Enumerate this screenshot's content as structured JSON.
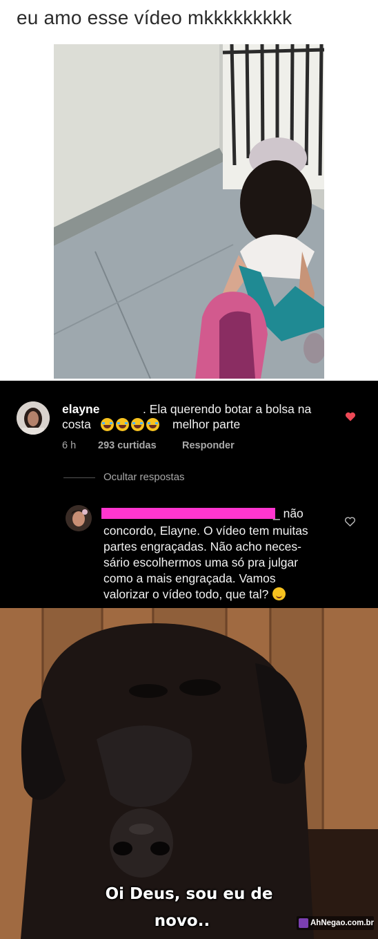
{
  "caption": {
    "text": "eu amo esse vídeo mkkkkkkkkk"
  },
  "comment": {
    "username": "elayne",
    "body_line_1": ". Ela querendo botar a bolsa na",
    "body_line_2_start": "costa",
    "body_line_2_end": "melhor parte",
    "emoji": "joy-emoji",
    "emoji_count": 4,
    "time": "6 h",
    "likes": "293 curtidas",
    "reply_label": "Responder",
    "liked": true,
    "heart_color": "#ed4956"
  },
  "hide_replies": "Ocultar respostas",
  "reply": {
    "username_suffix": "_ não",
    "lines": [
      "concordo, Elayne. O vídeo tem muitas",
      "partes engraçadas. Não acho neces-",
      "sário escolhermos uma só pra julgar",
      "como a mais engraçada. Vamos",
      "valorizar o vídeo todo, que tal?"
    ],
    "trailing_emoji": "wink-emoji",
    "redaction_color": "#ff36cf"
  },
  "meme": {
    "line_1": "Oi Deus, sou eu de",
    "line_2": "novo..",
    "watermark": "AhNegao.com.br"
  }
}
